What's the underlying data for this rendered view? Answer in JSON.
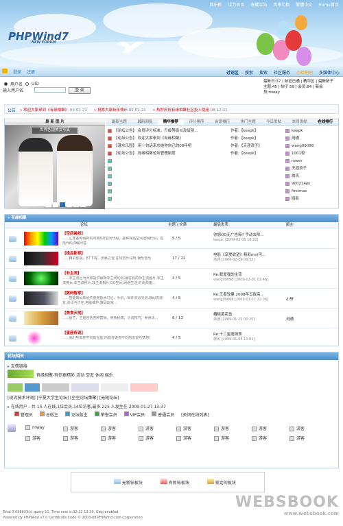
{
  "top_links": [
    "首乐新",
    "设为首页",
    "收藏本站",
    "风格切换",
    "繁體中文",
    "Home首页"
  ],
  "logo": {
    "main": "PHPWind7",
    "sub": "NEW FORUM"
  },
  "nav": {
    "left": [
      "登录",
      "注册"
    ],
    "right": [
      "讨论区",
      "搜索",
      "搜索",
      "社区服务",
      "小哈吧吧",
      "多媒体中心"
    ]
  },
  "login": {
    "radio_user": "用户名",
    "radio_uid": "UID",
    "field_label": "输入用户名",
    "login_button": "登 录"
  },
  "stats": {
    "line1": "最新日:37 | 帖证已通 | 精华区 | 最新帖子",
    "line2": "主题:45 | 帖子:59 | 会员:84 | 新会员:mway"
  },
  "announce": {
    "label": "公告",
    "items": [
      {
        "text": "欢迎大家来到《有缘相聚》",
        "date": "09-01-21"
      },
      {
        "text": "祝愿大家新年快乐",
        "date": "09-01-21"
      },
      {
        "text": "热烈庆祝有缘相聚社区投入使用",
        "date": "08-12-31"
      }
    ]
  },
  "hot": {
    "photo_title": "最 新 图 片",
    "photo_caption": "世界各国美女写真",
    "tabs": [
      "最新主题",
      "最新回复",
      "精华推荐",
      "评分排序",
      "会员排行",
      "热门主题",
      "今日发帖",
      "本月发帖",
      "在线排行"
    ],
    "active_tab": "精华推荐",
    "topics": [
      {
        "title": "【论坛公告】 会员评分标准，升级等级以及级别...",
        "author": "作者:【keepk】"
      },
      {
        "title": "【论坛公告】 欢迎大家来到《有缘相聚》",
        "author": "作者:【keepk】"
      },
      {
        "title": "【灌水乐园】 用一句话来总结你自己的08年吧",
        "author": "作者:【天涯浪子】"
      },
      {
        "title": "【论坛公告】 有缘相聚论坛管理制度",
        "author": "作者:【keepk】"
      }
    ],
    "members": [
      "keepk",
      "测通",
      "wang09098",
      "1001夜",
      "nxeer",
      "天涯浪子",
      "旅风",
      "900214jin",
      "firstmac",
      "鸥影"
    ]
  },
  "forums": {
    "section_title": "有缘相聚",
    "columns": [
      "论坛",
      "主题 / 文章",
      "最后发表",
      "版主"
    ],
    "rows": [
      {
        "name": "【空间装扮】",
        "desc": "......汇集各种最新的可用QQ空间代码，各种网站空间透明代码，包括代码详解问答",
        "count": "5 / 5",
        "last_title": "你想QQ无广告嘛? 手动去除...",
        "last_meta": "keepk [2009-02-05 18:32]",
        "mod": ""
      },
      {
        "name": "【极品影视】",
        "desc": "......精彩影视。BT下载、天籁之音,在线音乐试听,娱乐音乐",
        "count": "17 / 22",
        "last_title": "电影《享受欲望》精彩mv(可...",
        "last_meta": "测通 [2009-02-09 09:52]",
        "mod": ""
      },
      {
        "name": "【非主流】",
        "desc": "......非主流区为大家提供最新非主流论坛,最好看的非主流图片,非主流美女,非主流照片,非主流相片,QQ空间,网络生活,时尚颓废...",
        "count": "4 / 5",
        "last_title": "Re:我爱我的主流",
        "last_meta": "wang09098 [2009-02-01 01:48]",
        "mod": ""
      },
      {
        "name": "【数码智家】",
        "desc": "......智能数码软硬件使用技术讨论，手机、软件资源交流,数码发烧友,资讯与讨论,电脑维护,数码玩家...",
        "count": "4 / 5",
        "last_title": "Re:王者较量 2008年五款高...",
        "last_meta": "wang09098 [2009-01-27 22:06]",
        "mod": "小轩"
      },
      {
        "name": "【美食天地】",
        "desc": "......厨艺，主题包括各种营销，美食秘籍，烹调技巧，美食诀...",
        "count": "8 / 11",
        "last_title": "糟糕黄花鱼",
        "last_meta": "测通 [2009-01-22 00:20]",
        "mod": "测通"
      },
      {
        "name": "【星座传说】",
        "desc": "......我们所有你不同的星座,所有传说你不同的愿望与梦想!",
        "count": "4 / 5",
        "last_title": "Re:十二星座简表",
        "last_meta": "旅风 [2009-01-05 10:01]",
        "mod": ""
      }
    ]
  },
  "links": {
    "section_title": "论坛相关",
    "friend_title": "友情链接",
    "friend_text": "有缘相聚-有你更精彩  活动  交友  休闲  娱乐",
    "friend_line2": "[现流技术评测] [宁夏大学生论坛] [空空论坛集聚] [无限论坛]",
    "online_line": "在线用户 - 共 15 人在线,1位会员,14位访客,最多 225 人发生在 2009-01-27 13:37",
    "legend": [
      "管理员",
      "总版主",
      "论坛版主",
      "荣誉会员",
      "VIP会员",
      "普通会员",
      "[关闭在线列表]"
    ],
    "online_users": [
      "mway",
      "游客",
      "游客",
      "游客",
      "游客",
      "游客",
      "游客",
      "游客",
      "游客",
      "游客",
      "游客",
      "游客",
      "游客",
      "游客",
      "游客",
      "游客"
    ]
  },
  "forum_legend": [
    "无新帖板块",
    "有新帖板块",
    "锁定的板块"
  ],
  "footer": {
    "line1": "Total 0.038633(s) query 11, Time now is:02:22 13:30, Gzip enabled",
    "line2": "Powered by PHPWind v7.0 Certificate Code © 2003-08 PHPWind.com Corporation"
  },
  "watermark": {
    "big": "WEBSBOOK",
    "small": "www.websbook.com"
  },
  "colors": {
    "nav_blue": "#0a3f7a",
    "red": "#d40000",
    "header_blue": "#4c8fcc"
  }
}
